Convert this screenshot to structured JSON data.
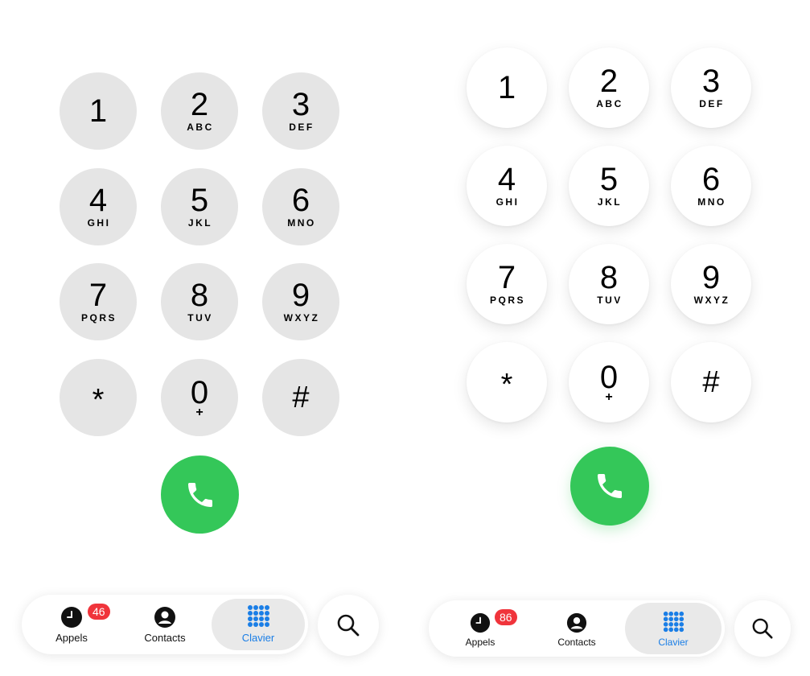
{
  "colors": {
    "call_green": "#34c759",
    "badge_red": "#f0343b",
    "active_blue": "#1a7ee6",
    "key_gray": "#e5e5e5"
  },
  "keypad": [
    {
      "digit": "1",
      "letters": ""
    },
    {
      "digit": "2",
      "letters": "ABC"
    },
    {
      "digit": "3",
      "letters": "DEF"
    },
    {
      "digit": "4",
      "letters": "GHI"
    },
    {
      "digit": "5",
      "letters": "JKL"
    },
    {
      "digit": "6",
      "letters": "MNO"
    },
    {
      "digit": "7",
      "letters": "PQRS"
    },
    {
      "digit": "8",
      "letters": "TUV"
    },
    {
      "digit": "9",
      "letters": "WXYZ"
    },
    {
      "digit": "*",
      "letters": ""
    },
    {
      "digit": "0",
      "letters": "+"
    },
    {
      "digit": "#",
      "letters": ""
    }
  ],
  "left": {
    "tabs": [
      {
        "label": "Appels",
        "icon": "clock-icon",
        "badge": "46"
      },
      {
        "label": "Contacts",
        "icon": "person-circle-icon"
      },
      {
        "label": "Clavier",
        "icon": "keypad-grid-icon"
      }
    ],
    "active_tab": "Clavier"
  },
  "right": {
    "tabs": [
      {
        "label": "Appels",
        "icon": "clock-icon",
        "badge": "86"
      },
      {
        "label": "Contacts",
        "icon": "person-circle-icon"
      },
      {
        "label": "Clavier",
        "icon": "keypad-grid-icon"
      }
    ],
    "active_tab": "Clavier"
  }
}
